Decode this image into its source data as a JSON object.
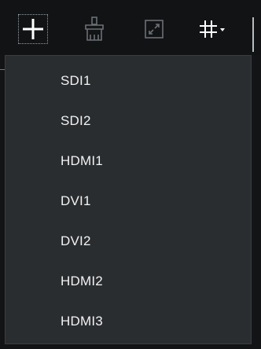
{
  "toolbar": {
    "buttons": [
      {
        "name": "add",
        "icon": "plus-icon"
      },
      {
        "name": "clear",
        "icon": "brush-icon"
      },
      {
        "name": "fullscreen",
        "icon": "expand-icon"
      },
      {
        "name": "grid",
        "icon": "grid-dropdown-icon"
      }
    ]
  },
  "menu": {
    "items": [
      {
        "label": "SDI1"
      },
      {
        "label": "SDI2"
      },
      {
        "label": "HDMI1"
      },
      {
        "label": "DVI1"
      },
      {
        "label": "DVI2"
      },
      {
        "label": "HDMI2"
      },
      {
        "label": "HDMI3"
      }
    ]
  },
  "colors": {
    "background": "#121416",
    "menu_bg": "#2a2d30",
    "text": "#f2f2f2",
    "icon_bright": "#ffffff",
    "icon_dim": "#6c7075"
  }
}
